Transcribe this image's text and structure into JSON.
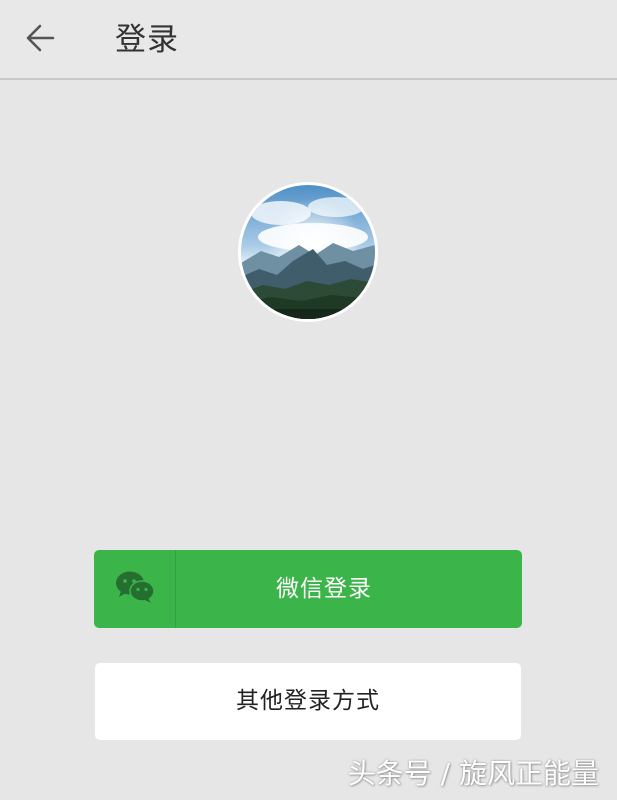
{
  "header": {
    "back_icon": "arrow-left-icon",
    "title": "登录"
  },
  "avatar": {
    "description_icon": "avatar-landscape"
  },
  "buttons": {
    "wechat_login": {
      "label": "微信登录",
      "icon": "wechat-icon",
      "color": "#3bb54a"
    },
    "other_login": {
      "label": "其他登录方式",
      "color": "#ffffff"
    }
  },
  "watermark": {
    "text": "头条号 / 旋风正能量"
  },
  "colors": {
    "background": "#e6e6e6",
    "accent_green": "#3bb54a"
  }
}
